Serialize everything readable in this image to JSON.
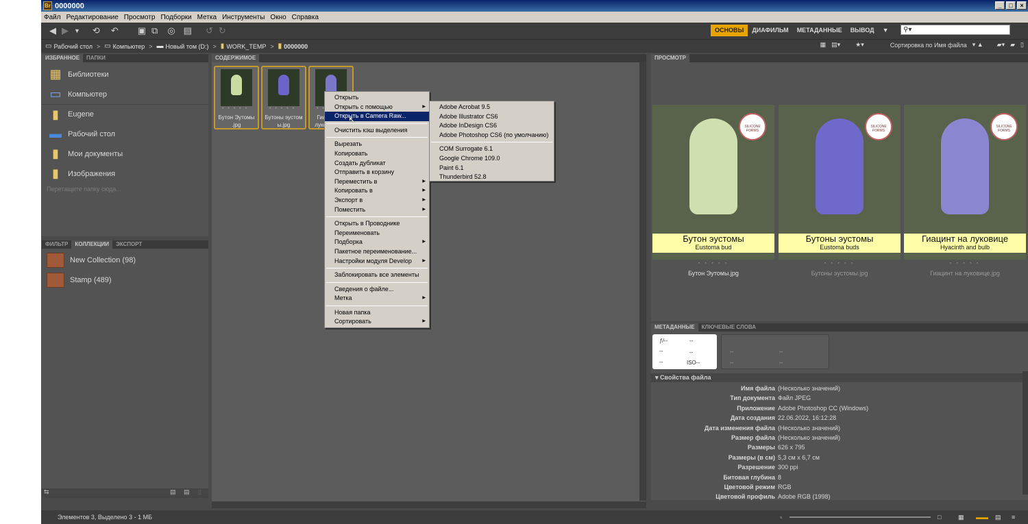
{
  "title": "0000000",
  "app_icon": "Br",
  "menu": [
    "Файл",
    "Редактирование",
    "Просмотр",
    "Подборки",
    "Метка",
    "Инструменты",
    "Окно",
    "Справка"
  ],
  "workspaces": [
    "ОСНОВЫ",
    "ДИАФИЛЬМ",
    "МЕТАДАННЫЕ",
    "ВЫВОД"
  ],
  "search": {
    "placeholder": ""
  },
  "breadcrumb": [
    "Рабочий стол",
    "Компьютер",
    "Новый том (D:)",
    "WORK_TEMP",
    "0000000"
  ],
  "sort_label": "Сортировка по Имя файла",
  "panels": {
    "favorites_tabs": [
      "ИЗБРАННОЕ",
      "ПАПКИ"
    ],
    "content_tab": "СОДЕРЖИМОЕ",
    "preview_tab": "ПРОСМОТР",
    "filter_tabs": [
      "ФИЛЬТР",
      "КОЛЛЕКЦИИ",
      "ЭКСПОРТ"
    ],
    "meta_tabs": [
      "МЕТАДАННЫЕ",
      "КЛЮЧЕВЫЕ СЛОВА"
    ]
  },
  "favorites": [
    "Библиотеки",
    "Компьютер",
    "Eugene",
    "Рабочий стол",
    "Мои документы",
    "Изображения"
  ],
  "favorites_hint": "Перетащите папку сюда...",
  "collections": [
    "New Collection (98)",
    "Stamp (489)"
  ],
  "thumbs": [
    {
      "caption": "Бутон Эутомы .jpg"
    },
    {
      "caption": "Бутоны эустом ы.jpg"
    },
    {
      "caption": "Гиацинт на луковице.jpg"
    }
  ],
  "preview": [
    {
      "title": "Бутон эустомы",
      "subtitle": "Eustoma bud",
      "file": "Бутон Эутомы.jpg"
    },
    {
      "title": "Бутоны эустомы",
      "subtitle": "Eustoma buds",
      "file": "Бутоны эустомы.jpg"
    },
    {
      "title": "Гиацинт на луковице",
      "subtitle": "Hyacinth and bulb",
      "file": "Гиацинт на луковице.jpg"
    }
  ],
  "stamp_text": "SILICONE FORMS",
  "meta_box": {
    "f": "ƒ/--",
    "a": "--",
    "b": "--",
    "c": "--",
    "d": "--",
    "iso": "ISO--",
    "e": "--",
    "g": "--",
    "h": "--",
    "i": "--"
  },
  "file_props_title": "Свойства файла",
  "file_props": [
    {
      "k": "Имя файла",
      "v": "(Несколько значений)"
    },
    {
      "k": "Тип документа",
      "v": "Файл JPEG"
    },
    {
      "k": "Приложение",
      "v": "Adobe Photoshop CC (Windows)"
    },
    {
      "k": "Дата создания",
      "v": "22.06.2022, 16:12:28"
    },
    {
      "k": "Дата изменения файла",
      "v": "(Несколько значений)"
    },
    {
      "k": "Размер файла",
      "v": "(Несколько значений)"
    },
    {
      "k": "Размеры",
      "v": "626 x 795"
    },
    {
      "k": "Размеры (в см)",
      "v": "5,3 см x 6,7 см"
    },
    {
      "k": "Разрешение",
      "v": "300 ppi"
    },
    {
      "k": "Битовая глубина",
      "v": "8"
    },
    {
      "k": "Цветовой режим",
      "v": "RGB"
    },
    {
      "k": "Цветовой профиль",
      "v": "Adobe RGB (1998)"
    }
  ],
  "status": "Элементов 3, Выделено 3 - 1 МБ",
  "context_menu": [
    [
      {
        "label": "Открыть"
      },
      {
        "label": "Открыть с помощью",
        "sub": true
      },
      {
        "label": "Открыть в Camera Raw...",
        "hl": true
      }
    ],
    [
      {
        "label": "Очистить кэш выделения"
      }
    ],
    [
      {
        "label": "Вырезать"
      },
      {
        "label": "Копировать"
      },
      {
        "label": "Создать дубликат"
      },
      {
        "label": "Отправить в корзину"
      },
      {
        "label": "Переместить в",
        "sub": true
      },
      {
        "label": "Копировать в",
        "sub": true
      },
      {
        "label": "Экспорт в",
        "sub": true
      },
      {
        "label": "Поместить",
        "sub": true
      }
    ],
    [
      {
        "label": "Открыть в Проводнике"
      },
      {
        "label": "Переименовать"
      },
      {
        "label": "Подборка",
        "sub": true
      },
      {
        "label": "Пакетное переименование..."
      },
      {
        "label": "Настройки модуля Develop",
        "sub": true
      }
    ],
    [
      {
        "label": "Заблокировать все элементы"
      }
    ],
    [
      {
        "label": "Сведения о файле..."
      },
      {
        "label": "Метка",
        "sub": true
      }
    ],
    [
      {
        "label": "Новая папка"
      },
      {
        "label": "Сортировать",
        "sub": true
      }
    ]
  ],
  "submenu": [
    [
      "Adobe Acrobat 9.5",
      "Adobe Illustrator CS6",
      "Adobe InDesign CS6",
      "Adobe Photoshop CS6 (по умолчанию)"
    ],
    [
      "COM Surrogate 6.1",
      "Google Chrome 109.0",
      "Paint 6.1",
      "Thunderbird 52.8"
    ]
  ],
  "colors": {
    "accent": "#e8a400",
    "highlight": "#0a246a",
    "label_bg": "#fefea8"
  }
}
